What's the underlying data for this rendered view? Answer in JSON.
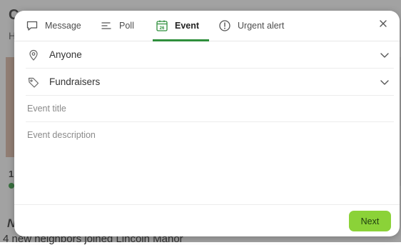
{
  "background": {
    "heading": "C",
    "subtext": "H",
    "count": "1",
    "section_letter": "N",
    "footer_text": "4 new neighbors joined Lincoln Manor"
  },
  "modal": {
    "tabs": [
      {
        "label": "Message",
        "icon": "message-icon"
      },
      {
        "label": "Poll",
        "icon": "poll-icon"
      },
      {
        "label": "Event",
        "icon": "calendar-icon",
        "icon_text": "26",
        "active": true
      },
      {
        "label": "Urgent alert",
        "icon": "alert-icon"
      }
    ],
    "audience": {
      "label": "Anyone",
      "icon": "location-pin-icon"
    },
    "category": {
      "label": "Fundraisers",
      "icon": "tag-icon"
    },
    "event_title": {
      "placeholder": "Event title",
      "value": ""
    },
    "event_description": {
      "placeholder": "Event description",
      "value": ""
    },
    "next_label": "Next"
  },
  "colors": {
    "accent": "#2f8f3c",
    "next_button": "#8bd238",
    "modal_bg": "#ffffff",
    "overlay": "#6e6e6e"
  }
}
